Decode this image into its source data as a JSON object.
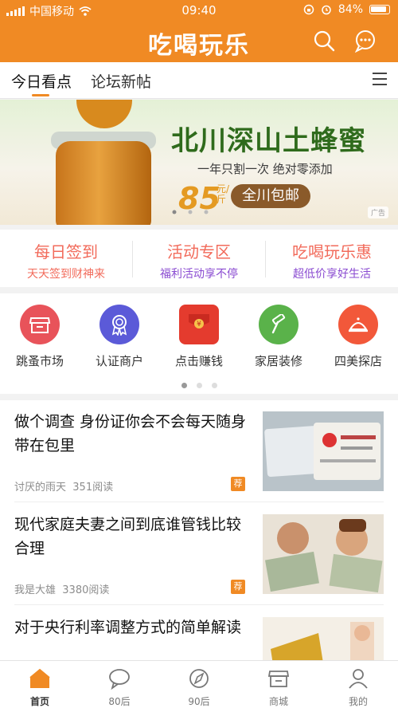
{
  "status": {
    "carrier": "中国移动",
    "time": "09:40",
    "battery": "84%"
  },
  "header": {
    "title": "吃喝玩乐"
  },
  "tabs": [
    {
      "label": "今日看点",
      "active": true
    },
    {
      "label": "论坛新帖",
      "active": false
    }
  ],
  "banner": {
    "title": "北川深山土蜂蜜",
    "subtitle": "一年只割一次  绝对零添加",
    "price": "85",
    "unit": "元/斤",
    "button": "全川包邮",
    "ad_tag": "广告"
  },
  "features": [
    {
      "title": "每日签到",
      "subtitle": "天天签到财神来",
      "subtitle_color": "#f26b5b"
    },
    {
      "title": "活动专区",
      "subtitle": "福利活动享不停",
      "subtitle_color": "#8a4bd1"
    },
    {
      "title": "吃喝玩乐惠",
      "subtitle": "超低价享好生活",
      "subtitle_color": "#8a4bd1"
    }
  ],
  "grid": [
    {
      "label": "跳蚤市场",
      "icon": "store-icon",
      "color": "#e8535a"
    },
    {
      "label": "认证商户",
      "icon": "certificate-icon",
      "color": "#5b5ad8"
    },
    {
      "label": "点击赚钱",
      "icon": "red-envelope-icon",
      "color": "#e43b2e"
    },
    {
      "label": "家居装修",
      "icon": "hammer-icon",
      "color": "#5ab24a"
    },
    {
      "label": "四美探店",
      "icon": "food-tray-icon",
      "color": "#f2583a"
    }
  ],
  "articles": [
    {
      "title": "做个调查 身份证你会不会每天随身带在包里",
      "author": "讨厌的雨天",
      "reads": "351阅读",
      "badge": "荐",
      "thumb": "id-card-image"
    },
    {
      "title": "现代家庭夫妻之间到底谁管钱比较合理",
      "author": "我是大雄",
      "reads": "3380阅读",
      "badge": "荐",
      "thumb": "couple-money-image"
    },
    {
      "title": "对于央行利率调整方式的简单解读",
      "author": "",
      "reads": "",
      "badge": "",
      "thumb": "bank-image"
    }
  ],
  "tabbar": [
    {
      "label": "首页",
      "icon": "home-icon",
      "active": true
    },
    {
      "label": "80后",
      "icon": "chat-bubble-icon",
      "active": false
    },
    {
      "label": "90后",
      "icon": "compass-icon",
      "active": false
    },
    {
      "label": "商城",
      "icon": "shop-icon",
      "active": false
    },
    {
      "label": "我的",
      "icon": "person-icon",
      "active": false
    }
  ],
  "colors": {
    "brand": "#f08a24",
    "feature_title": "#f26b5b"
  }
}
